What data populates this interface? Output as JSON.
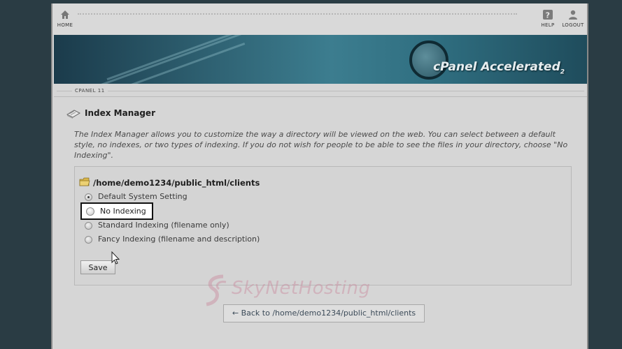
{
  "toolbar": {
    "home_label": "HOME",
    "help_label": "HELP",
    "logout_label": "LOGOUT"
  },
  "banner": {
    "brand": "cPanel Accelerated",
    "brand_version": "2"
  },
  "breadcrumb": {
    "label": "CPANEL 11"
  },
  "page": {
    "title": "Index Manager",
    "description": "The Index Manager allows you to customize the way a directory will be viewed on the web. You can select between a default style, no indexes, or two types of indexing. If you do not wish for people to be able to see the files in your directory, choose \"No Indexing\"."
  },
  "form": {
    "directory_path": "/home/demo1234/public_html/clients",
    "options": [
      {
        "label": "Default System Setting",
        "checked": true
      },
      {
        "label": "No Indexing",
        "checked": false
      },
      {
        "label": "Standard Indexing (filename only)",
        "checked": false
      },
      {
        "label": "Fancy Indexing (filename and description)",
        "checked": false
      }
    ],
    "save_label": "Save"
  },
  "watermark": {
    "text": "SkyNetHosting"
  },
  "back_link": {
    "label": "← Back to /home/demo1234/public_html/clients"
  },
  "colors": {
    "background": "#2a3c44",
    "page": "#d6d6d6",
    "banner": "#2f6273",
    "highlight_border": "#111111"
  }
}
